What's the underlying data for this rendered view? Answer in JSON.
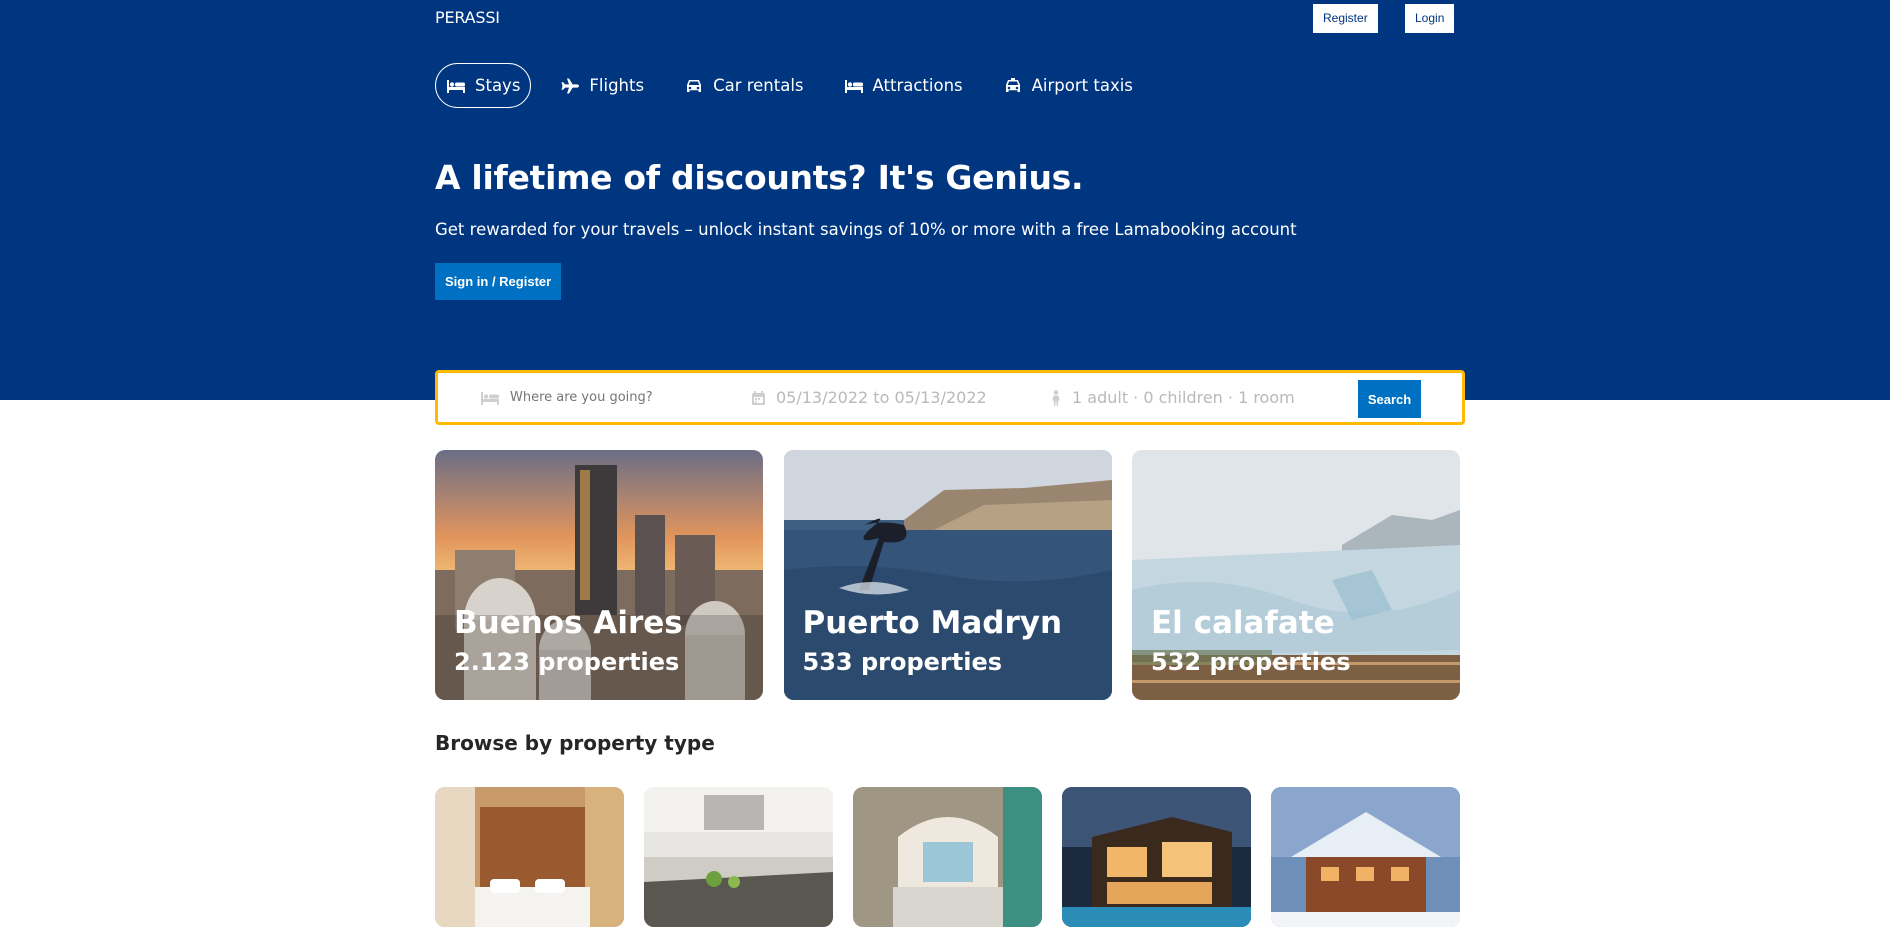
{
  "brand": {
    "logo": "PERASSI"
  },
  "auth": {
    "register": "Register",
    "login": "Login"
  },
  "nav": [
    {
      "label": "Stays",
      "icon": "bed-icon",
      "active": true
    },
    {
      "label": "Flights",
      "icon": "plane-icon",
      "active": false
    },
    {
      "label": "Car rentals",
      "icon": "car-icon",
      "active": false
    },
    {
      "label": "Attractions",
      "icon": "bed-icon",
      "active": false
    },
    {
      "label": "Airport taxis",
      "icon": "taxi-icon",
      "active": false
    }
  ],
  "hero": {
    "title": "A lifetime of discounts? It's Genius.",
    "subtitle": "Get rewarded for your travels – unlock instant savings of 10% or more with a free Lamabooking account",
    "button": "Sign in / Register"
  },
  "search": {
    "destination_placeholder": "Where are you going?",
    "destination_icon": "bed-icon",
    "dates": "05/13/2022 to 05/13/2022",
    "dates_icon": "calendar-icon",
    "guests": "1 adult · 0 children · 1 room",
    "guests_icon": "person-icon",
    "button": "Search"
  },
  "featured": [
    {
      "city": "Buenos Aires",
      "properties": "2.123 properties"
    },
    {
      "city": "Puerto Madryn",
      "properties": "533 properties"
    },
    {
      "city": "El calafate",
      "properties": "532 properties"
    }
  ],
  "browse": {
    "title": "Browse by property type"
  },
  "colors": {
    "brand_blue": "#003580",
    "button_blue": "#0071c2",
    "search_border": "#febb02"
  }
}
